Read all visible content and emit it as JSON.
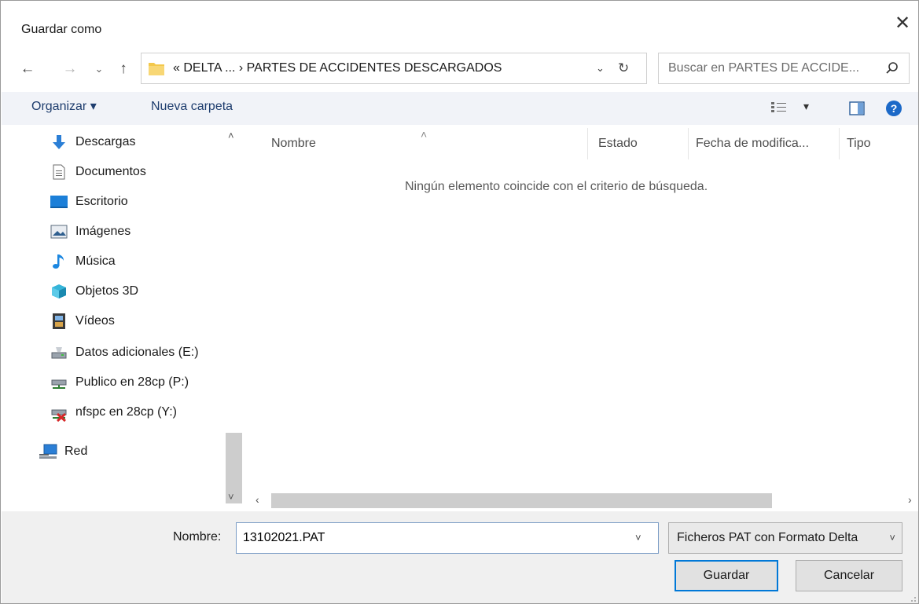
{
  "window": {
    "title": "Guardar como",
    "close_glyph": "✕"
  },
  "nav_buttons": {
    "back": "←",
    "forward": "→",
    "recent": "⌄",
    "up": "↑"
  },
  "address": {
    "path_text": "«  DELTA ...  ›  PARTES DE ACCIDENTES DESCARGADOS",
    "dropdown_glyph": "⌄",
    "refresh_glyph": "↻"
  },
  "search": {
    "placeholder": "Buscar en PARTES DE ACCIDE..."
  },
  "toolbar": {
    "organize_label": "Organizar ▾",
    "new_folder_label": "Nueva carpeta",
    "view_glyph": "▾"
  },
  "sidebar": {
    "items": [
      {
        "label": "Descargas",
        "icon": "download-arrow-icon"
      },
      {
        "label": "Documentos",
        "icon": "document-icon"
      },
      {
        "label": "Escritorio",
        "icon": "desktop-icon"
      },
      {
        "label": "Imágenes",
        "icon": "pictures-icon"
      },
      {
        "label": "Música",
        "icon": "music-note-icon"
      },
      {
        "label": "Objetos 3D",
        "icon": "cube-3d-icon"
      },
      {
        "label": "Vídeos",
        "icon": "film-icon"
      },
      {
        "label": "Datos adicionales (E:)",
        "icon": "drive-icon"
      },
      {
        "label": "Publico en 28cp (P:)",
        "icon": "network-drive-icon"
      },
      {
        "label": "nfspc en 28cp (Y:)",
        "icon": "disconnected-network-drive-icon"
      },
      {
        "label": "Red",
        "icon": "network-icon"
      }
    ]
  },
  "file_list": {
    "columns": [
      "Nombre",
      "Estado",
      "Fecha de modifica...",
      "Tipo"
    ],
    "empty_message": "Ningún elemento coincide con el criterio de búsqueda."
  },
  "bottom": {
    "name_label": "Nombre:",
    "filename_value": "13102021.PAT",
    "file_type": "Ficheros PAT con Formato Delta",
    "save_label": "Guardar",
    "cancel_label": "Cancelar"
  },
  "colors": {
    "accent": "#0078d7",
    "toolbar_bg": "#f1f3f8",
    "folder": "#f3c84b"
  }
}
